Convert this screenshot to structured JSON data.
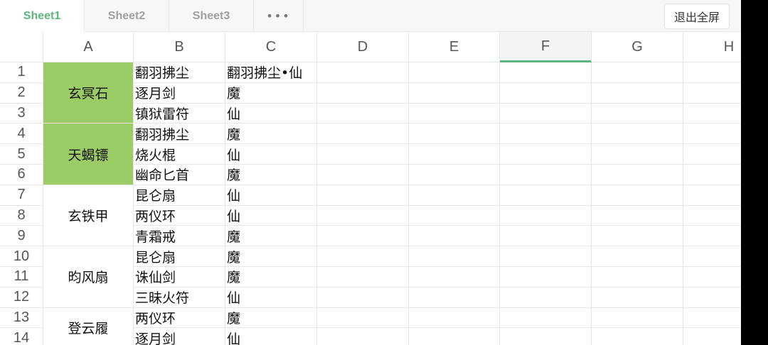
{
  "tabs": [
    {
      "label": "Sheet1",
      "active": true
    },
    {
      "label": "Sheet2"
    },
    {
      "label": "Sheet3"
    }
  ],
  "more_label": "•••",
  "exit_fullscreen_label": "退出全屏",
  "columns": [
    "A",
    "B",
    "C",
    "D",
    "E",
    "F",
    "G",
    "H"
  ],
  "selected_column": "F",
  "row_numbers": [
    "1",
    "2",
    "3",
    "4",
    "5",
    "6",
    "7",
    "8",
    "9",
    "10",
    "11",
    "12",
    "13",
    "14"
  ],
  "colors": {
    "accent": "#5fb57f",
    "highlight": "#9ccc65"
  },
  "merged_a": [
    {
      "label": "玄冥石",
      "start": 1,
      "span": 3,
      "highlight": true
    },
    {
      "label": "天蝎镖",
      "start": 4,
      "span": 3,
      "highlight": true
    },
    {
      "label": "玄铁甲",
      "start": 7,
      "span": 3
    },
    {
      "label": "昀风扇",
      "start": 10,
      "span": 3
    },
    {
      "label": "登云履",
      "start": 13,
      "span": 2
    }
  ],
  "rows": [
    [
      "翻羽拂尘",
      "翻羽拂尘•仙"
    ],
    [
      "逐月剑",
      "魔"
    ],
    [
      "镇狱雷符",
      "仙"
    ],
    [
      "翻羽拂尘",
      "魔"
    ],
    [
      "烧火棍",
      "仙"
    ],
    [
      "幽命匕首",
      "魔"
    ],
    [
      "昆仑扇",
      "仙"
    ],
    [
      "两仪环",
      "仙"
    ],
    [
      "青霜戒",
      "魔"
    ],
    [
      "昆仑扇",
      "魔"
    ],
    [
      "诛仙剑",
      "魔"
    ],
    [
      "三昧火符",
      "仙"
    ],
    [
      "两仪环",
      "魔"
    ],
    [
      "逐月剑",
      "仙"
    ]
  ]
}
